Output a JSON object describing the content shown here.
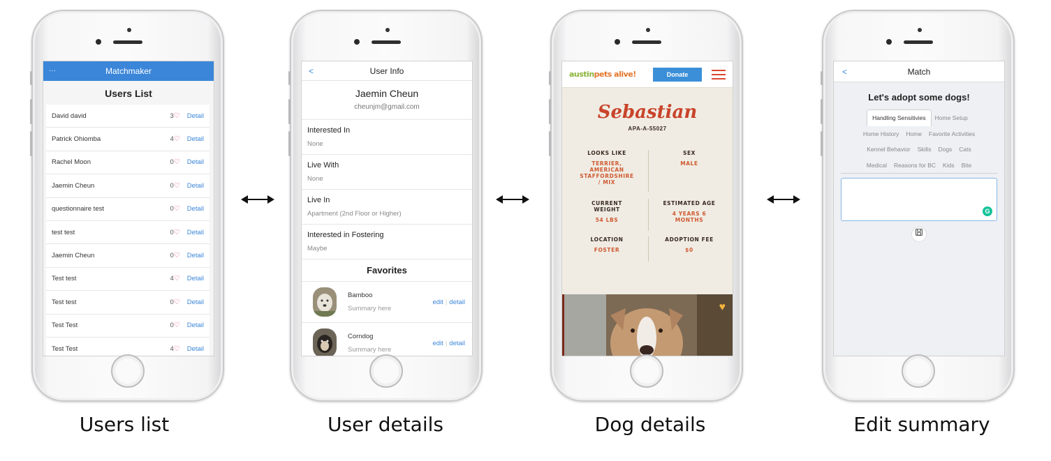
{
  "captions": [
    "Users list",
    "User details",
    "Dog details",
    "Edit summary"
  ],
  "users_screen": {
    "nav_title": "Matchmaker",
    "nav_menu": "···",
    "title": "Users List",
    "detail_label": "Detail",
    "heart_glyph": "♡",
    "users": [
      {
        "name": "David david",
        "count": "3"
      },
      {
        "name": "Patrick Ohiomba",
        "count": "4"
      },
      {
        "name": "Rachel Moon",
        "count": "0"
      },
      {
        "name": "Jaemin Cheun",
        "count": "0"
      },
      {
        "name": "questionnaire test",
        "count": "0"
      },
      {
        "name": "test test",
        "count": "0"
      },
      {
        "name": "Jaemin Cheun",
        "count": "0"
      },
      {
        "name": "Test test",
        "count": "4"
      },
      {
        "name": "Test test",
        "count": "0"
      },
      {
        "name": "Test Test",
        "count": "0"
      },
      {
        "name": "Test Test",
        "count": "4"
      }
    ]
  },
  "user_info_screen": {
    "back": "<",
    "title": "User Info",
    "name": "Jaemin Cheun",
    "email": "cheunjm@gmail.com",
    "fields": [
      {
        "label": "Interested In",
        "value": "None"
      },
      {
        "label": "Live With",
        "value": "None"
      },
      {
        "label": "Live In",
        "value": "Apartment (2nd Floor or Higher)"
      },
      {
        "label": "Interested in Fostering",
        "value": "Maybe"
      }
    ],
    "favorites_title": "Favorites",
    "favorites": [
      {
        "name": "Bamboo",
        "summary": "Summary here",
        "edit": "edit",
        "detail": "detail"
      },
      {
        "name": "Corndog",
        "summary": "Summary here",
        "edit": "edit",
        "detail": "detail"
      }
    ],
    "action_separator": "|"
  },
  "dog_screen": {
    "logo_part1": "austin",
    "logo_part2": "pets alive!",
    "donate": "Donate",
    "name": "Sebastian",
    "id": "APA-A-55027",
    "looks_like_label": "LOOKS LIKE",
    "looks_like_value": "TERRIER, AMERICAN STAFFORDSHIRE / MIX",
    "sex_label": "SEX",
    "sex_value": "MALE",
    "weight_label": "CURRENT WEIGHT",
    "weight_value": "54 LBS",
    "age_label": "ESTIMATED AGE",
    "age_value": "4 YEARS 6 MONTHS",
    "location_label": "LOCATION",
    "location_value": "FOSTER",
    "fee_label": "ADOPTION FEE",
    "fee_value": "$0",
    "colors": {
      "brand_red": "#c9432a",
      "green": "#8ab53a",
      "blue": "#3b8fd8"
    }
  },
  "match_screen": {
    "back": "<",
    "title": "Match",
    "heading": "Let's adopt some dogs!",
    "tabs_row1": [
      "Handling Sensitivies",
      "Home Setup"
    ],
    "tabs_row2": [
      "Home History",
      "Home",
      "Favorite Activities"
    ],
    "tabs_row3": [
      "Kennel Behavior",
      "Skills",
      "Dogs",
      "Cats"
    ],
    "tabs_row4": [
      "Medical",
      "Reasons for BC",
      "Kids",
      "Bite"
    ],
    "grammarly": "G",
    "save_icon": "save-icon"
  }
}
